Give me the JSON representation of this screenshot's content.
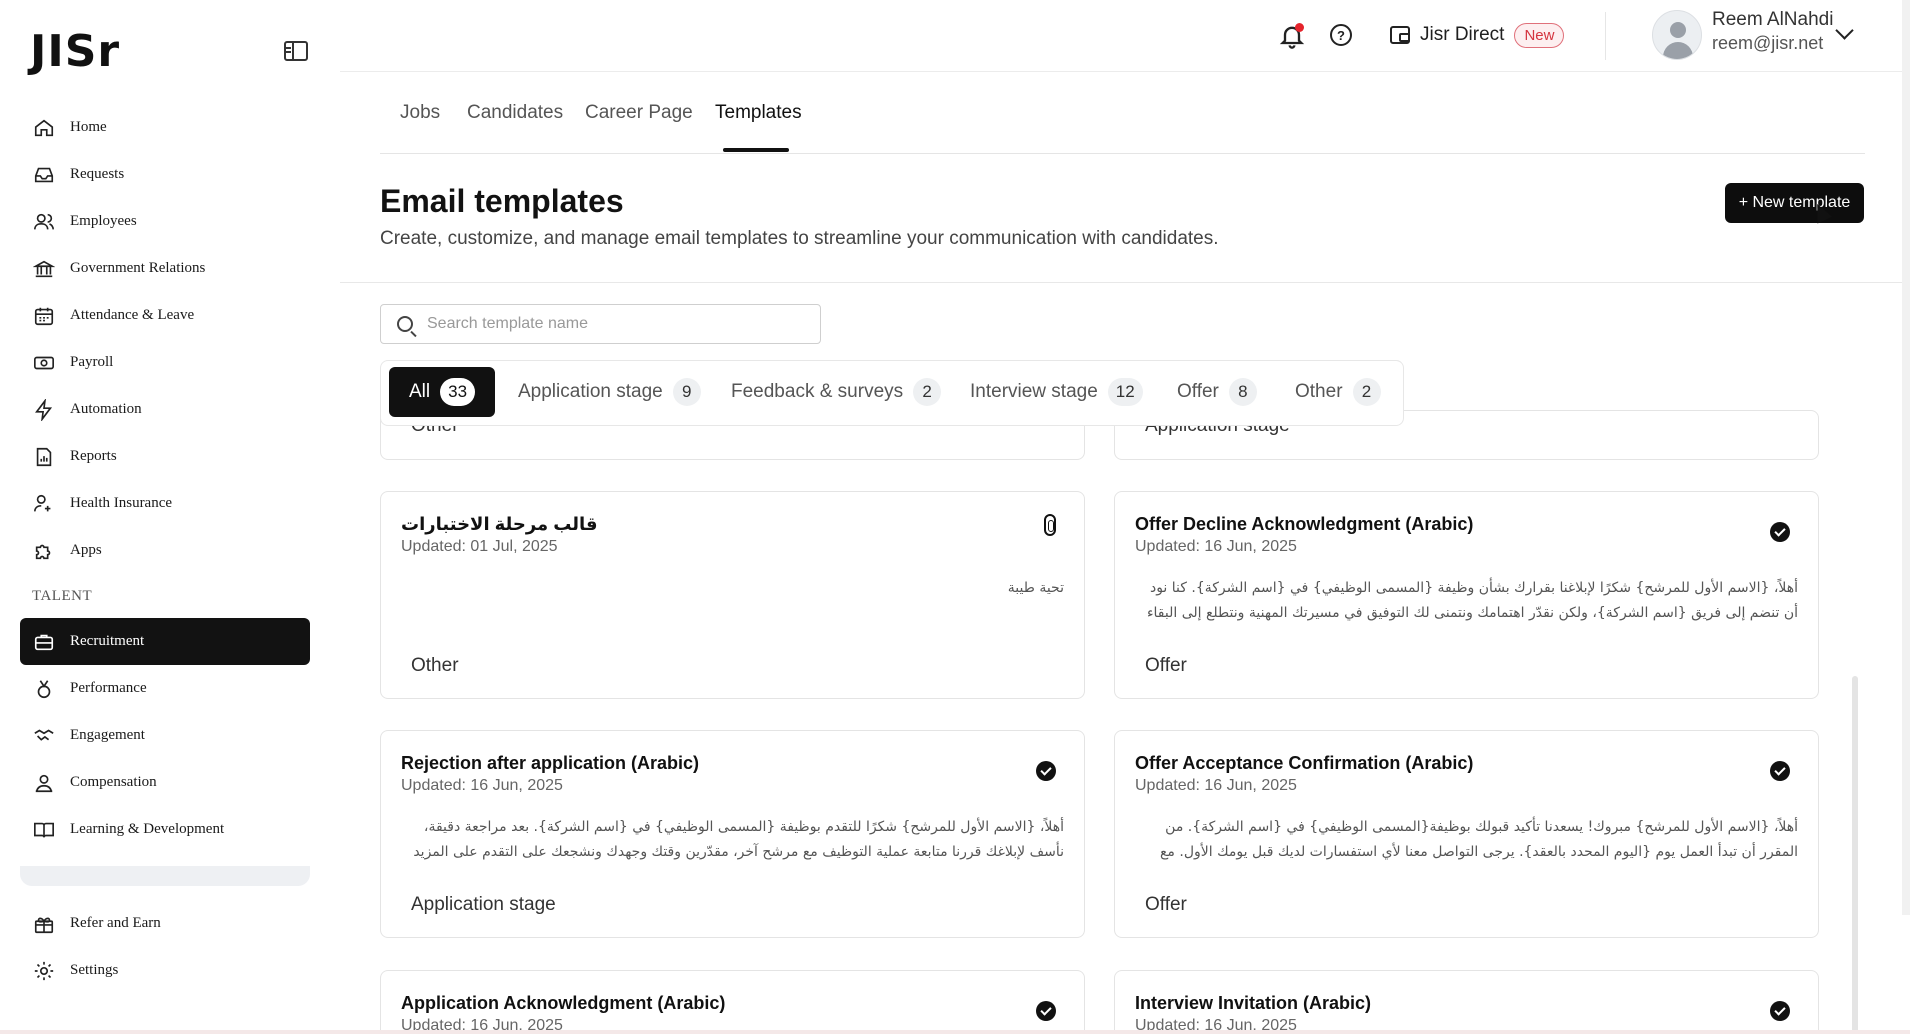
{
  "brand": {
    "logo": "JISr"
  },
  "sidebar": {
    "items": [
      {
        "label": "Home",
        "icon": "home-icon"
      },
      {
        "label": "Requests",
        "icon": "inbox-icon"
      },
      {
        "label": "Employees",
        "icon": "users-icon"
      },
      {
        "label": "Government Relations",
        "icon": "bank-icon"
      },
      {
        "label": "Attendance & Leave",
        "icon": "calendar-icon"
      },
      {
        "label": "Payroll",
        "icon": "money-icon"
      },
      {
        "label": "Automation",
        "icon": "automation-icon"
      },
      {
        "label": "Reports",
        "icon": "report-icon"
      },
      {
        "label": "Health Insurance",
        "icon": "health-icon"
      },
      {
        "label": "Apps",
        "icon": "puzzle-icon"
      }
    ],
    "section_label": "TALENT",
    "talent_items": [
      {
        "label": "Recruitment",
        "icon": "briefcase-icon",
        "active": true
      },
      {
        "label": "Performance",
        "icon": "medal-icon"
      },
      {
        "label": "Engagement",
        "icon": "handshake-icon"
      },
      {
        "label": "Compensation",
        "icon": "compensation-icon"
      },
      {
        "label": "Learning & Development",
        "icon": "book-icon"
      }
    ],
    "bottom_items": [
      {
        "label": "Refer and Earn",
        "icon": "gift-icon"
      },
      {
        "label": "Settings",
        "icon": "gear-icon"
      }
    ]
  },
  "header": {
    "jisr_direct": "Jisr Direct",
    "new_badge": "New",
    "user_name": "Reem AlNahdi",
    "user_email": "reem@jisr.net"
  },
  "tabs": [
    {
      "label": "Jobs"
    },
    {
      "label": "Candidates"
    },
    {
      "label": "Career Page"
    },
    {
      "label": "Templates",
      "active": true
    }
  ],
  "page": {
    "title": "Email templates",
    "subtitle": "Create, customize, and manage email templates to streamline your communication with candidates.",
    "new_template_label": "+ New template"
  },
  "search": {
    "placeholder": "Search template name"
  },
  "filters": [
    {
      "label": "All",
      "count": "33",
      "active": true
    },
    {
      "label": "Application stage",
      "count": "9"
    },
    {
      "label": "Feedback & surveys",
      "count": "2"
    },
    {
      "label": "Interview stage",
      "count": "12"
    },
    {
      "label": "Offer",
      "count": "8"
    },
    {
      "label": "Other",
      "count": "2"
    }
  ],
  "cards": [
    {
      "title": "",
      "updated": "",
      "body": "",
      "tag": "Other"
    },
    {
      "title": "",
      "updated": "",
      "body": "",
      "tag": "Application stage"
    },
    {
      "title": "قالب مرحلة الاختبارات",
      "updated": "Updated: 01 Jul, 2025",
      "body": "تحية طيبة",
      "tag": "Other"
    },
    {
      "title": "Offer Decline Acknowledgment (Arabic)",
      "updated": "Updated: 16 Jun, 2025",
      "body": "أهلاً، {الاسم الأول للمرشح} شكرًا لإبلاغنا بقرارك بشأن وظيفة {المسمى الوظيفي} في {اسم الشركة}. كنا نود أن تنضم إلى فريق {اسم الشركة}، ولكن نقدّر اهتمامك ونتمنى لك التوفيق في مسيرتك المهنية ونتطلع إلى البقاء على تواصل لأي ...",
      "tag": "Offer"
    },
    {
      "title": "Rejection after application (Arabic)",
      "updated": "Updated: 16 Jun, 2025",
      "body": "أهلاً، {الاسم الأول للمرشح} شكرًا للتقدم بوظيفة {المسمى الوظيفي} في {اسم الشركة}. بعد مراجعة دقيقة، نأسف لإبلاغك قررنا متابعة عملية التوظيف مع مرشح آخر، مقدّرين وقتك وجهدك ونشجعك على التقدم على المزيد من الفرص لدينا ...",
      "tag": "Application stage"
    },
    {
      "title": "Offer Acceptance Confirmation (Arabic)",
      "updated": "Updated: 16 Jun, 2025",
      "body": "أهلاً، {الاسم الأول للمرشح} مبروك! يسعدنا تأكيد قبولك بوظيفة{المسمى الوظيفي} في {اسم الشركة}. من المقرر أن تبدأ العمل يوم {اليوم المحدد بالعقد}. يرجى التواصل معنا لأي استفسارات لديك قبل يومك الأول. مع أطيب التحيات،{اسم...",
      "tag": "Offer"
    },
    {
      "title": "Application Acknowledgment (Arabic)",
      "updated": "Updated: 16 Jun, 2025",
      "body": "",
      "tag": ""
    },
    {
      "title": "Interview Invitation (Arabic)",
      "updated": "Updated: 16 Jun, 2025",
      "body": "",
      "tag": ""
    }
  ]
}
